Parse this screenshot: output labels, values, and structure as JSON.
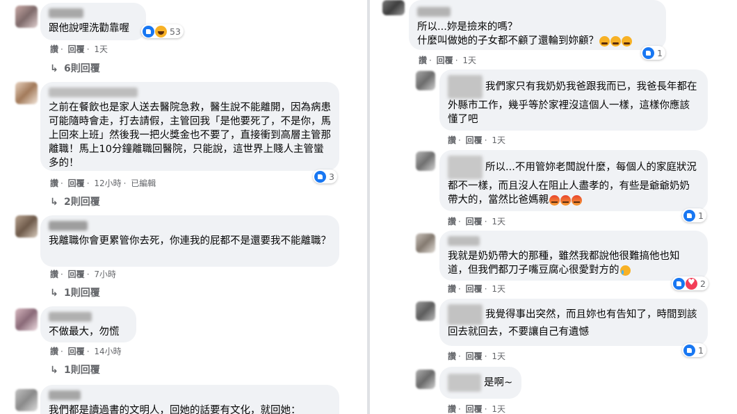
{
  "left": {
    "comments": [
      {
        "text": "跟他說哩洗勸靠喔",
        "reactions": {
          "count": "53"
        },
        "meta": {
          "like": "讚",
          "reply": "回覆",
          "time": "1天"
        },
        "replies": "6則回覆"
      },
      {
        "text": "之前在餐飲也是家人送去醫院急救，醫生說不能離開，因為病患可能隨時會走，打去請假，主管回我「是他要死了，不是你，馬上回來上班」然後我一把火獎金也不要了，直接衝到高層主管那離職！馬上10分鐘離職回醫院，只能說，這世界上賤人主管蠻多的！",
        "reactions": {
          "count": "3"
        },
        "meta": {
          "like": "讚",
          "reply": "回覆",
          "time": "12小時",
          "edited": "已編輯"
        },
        "replies": "2則回覆"
      },
      {
        "text": "我離職你會更累管你去死，你連我的屁都不是還要我不能離職？",
        "meta": {
          "like": "讚",
          "reply": "回覆",
          "time": "7小時"
        },
        "replies": "1則回覆"
      },
      {
        "text": "不做最大，勿慌",
        "meta": {
          "like": "讚",
          "reply": "回覆",
          "time": "14小時"
        },
        "replies": "1則回覆"
      },
      {
        "text": "我們都是讀過書的文明人，回她的話要有文化，就回她："
      }
    ]
  },
  "right": {
    "comments": [
      {
        "text_line1": "所以...妳是撿來的嗎？",
        "text_line2": "什麼叫做她的子女都不顧了還輪到妳顧？",
        "reactions": {
          "count": "1"
        },
        "meta": {
          "like": "讚",
          "reply": "回覆",
          "time": "1天"
        }
      },
      {
        "text": "我們家只有我奶奶我爸跟我而已，我爸長年都在外縣市工作，幾乎等於家裡沒這個人一樣，這樣你應該懂了吧",
        "meta": {
          "like": "讚",
          "reply": "回覆",
          "time": "1天"
        }
      },
      {
        "text": "所以...不用管妳老闆說什麼，每個人的家庭狀況都不一樣，而且沒人在阻止人盡孝的，有些是爺爺奶奶帶大的，當然比爸媽親",
        "reactions": {
          "count": "1"
        },
        "meta": {
          "like": "讚",
          "reply": "回覆",
          "time": "1天"
        }
      },
      {
        "text": "我就是奶奶帶大的那種，雖然我都說他很難搞他也知道，但我們都刀子嘴豆腐心很愛對方的",
        "reactions": {
          "count": "2"
        },
        "meta": {
          "like": "讚",
          "reply": "回覆",
          "time": "1天"
        }
      },
      {
        "text": "我覺得事出突然，而且妳也有告知了，時間到該回去就回去，不要讓自己有遺憾",
        "reactions": {
          "count": "1"
        },
        "meta": {
          "like": "讚",
          "reply": "回覆",
          "time": "1天"
        }
      },
      {
        "text": "是啊~",
        "meta": {
          "like": "讚",
          "reply": "回覆",
          "time": "1天"
        }
      }
    ]
  },
  "colors": {
    "bubble": "#f0f2f5",
    "meta": "#65676b",
    "like": "#1877f2",
    "love": "#f33e58",
    "haha": "#f7b125"
  }
}
